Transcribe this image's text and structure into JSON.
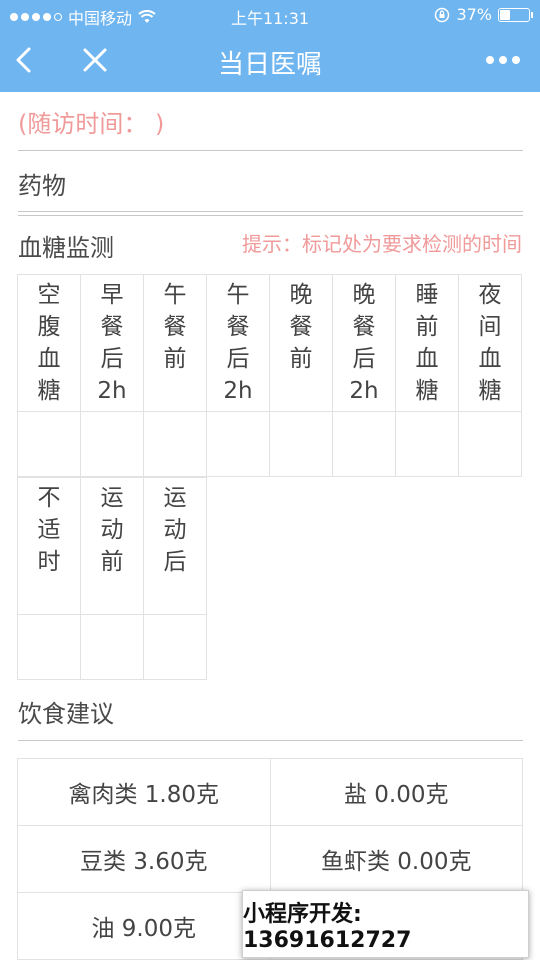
{
  "status": {
    "carrier": "中国移动",
    "time": "上午11:31",
    "battery": "37%",
    "battery_level": 0.37
  },
  "nav": {
    "title": "当日医嘱",
    "back_icon": "chevron-left-icon",
    "close_icon": "close-icon",
    "more_icon": "more-icon"
  },
  "visit_time": "(随访时间： )",
  "sections": {
    "medicine": "药物",
    "glucose": "血糖监测",
    "glucose_tip": "提示：标记处为要求检测的时间",
    "diet": "饮食建议"
  },
  "glucose_row1": [
    "空腹血糖",
    "早餐后2h",
    "午餐前",
    "午餐后2h",
    "晚餐前",
    "晚餐后2h",
    "睡前血糖",
    "夜间血糖"
  ],
  "glucose_row2": [
    "不适时",
    "运动前",
    "运动后"
  ],
  "diet": [
    [
      "禽肉类 1.80克",
      "盐 0.00克"
    ],
    [
      "豆类 3.60克",
      "鱼虾类 0.00克"
    ],
    [
      "油 9.00克",
      ""
    ]
  ],
  "dev_banner": "小程序开发: 13691612727",
  "colors": {
    "accent": "#6fb5ef",
    "tip": "#f09a9a"
  }
}
